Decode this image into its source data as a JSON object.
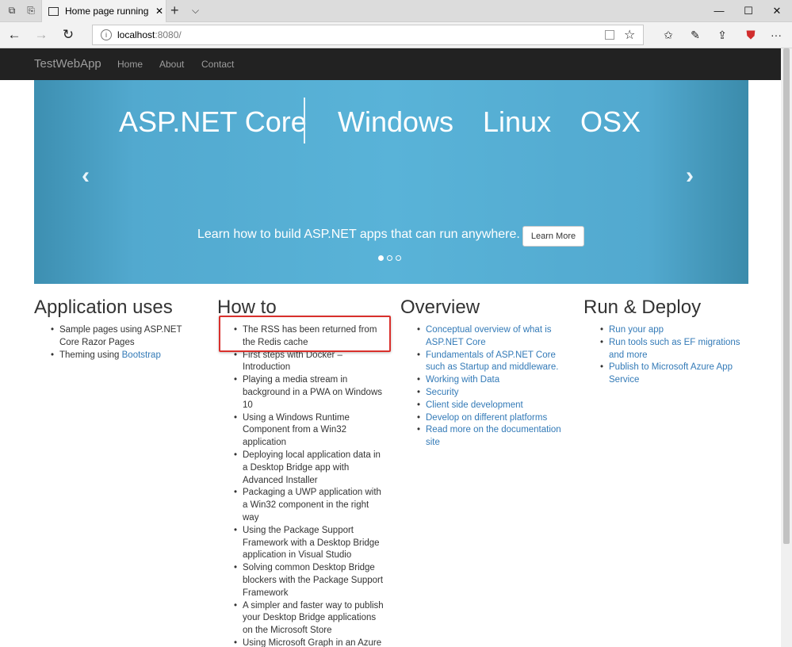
{
  "browser": {
    "tab_title": "Home page running ins",
    "url_host": "localhost",
    "url_port": ":8080/",
    "icons": {
      "back": "←",
      "forward": "→",
      "refresh": "↻",
      "info": "i",
      "star": "☆",
      "favorites": "✩",
      "pen": "✎",
      "share": "⇪",
      "shield": "⛊",
      "new_tab": "+",
      "tab_menu": "⌵",
      "close": "✕",
      "minimize": "—",
      "maximize": "☐"
    }
  },
  "site": {
    "brand": "TestWebApp",
    "nav": [
      "Home",
      "About",
      "Contact"
    ]
  },
  "carousel": {
    "headings": [
      "ASP.NET Core",
      "Windows",
      "Linux",
      "OSX"
    ],
    "prev_arrow": "‹",
    "next_arrow": "›",
    "caption": "Learn how to build ASP.NET apps that can run anywhere.",
    "button": "Learn More",
    "slide_count": 3,
    "active_slide": 1,
    "colors": {
      "background": "#59b3d8"
    }
  },
  "columns": {
    "application_uses": {
      "title": "Application uses",
      "item1": "Sample pages using ASP.NET Core Razor Pages",
      "item2_prefix": "Theming using ",
      "item2_link": "Bootstrap"
    },
    "how_to": {
      "title": "How to",
      "items": [
        "The RSS has been returned from the Redis cache",
        "First steps with Docker – Introduction",
        "Playing a media stream in background in a PWA on Windows 10",
        "Using a Windows Runtime Component from a Win32 application",
        "Deploying local application data in a Desktop Bridge app with Advanced Installer",
        "Packaging a UWP application with a Win32 component in the right way",
        "Using the Package Support Framework with a Desktop Bridge application in Visual Studio",
        "Solving common Desktop Bridge blockers with the Package Support Framework",
        "A simpler and faster way to publish your Desktop Bridge applications on the Microsoft Store",
        "Using Microsoft Graph in an Azure"
      ]
    },
    "overview": {
      "title": "Overview",
      "items": [
        "Conceptual overview of what is ASP.NET Core",
        "Fundamentals of ASP.NET Core such as Startup and middleware.",
        "Working with Data",
        "Security",
        "Client side development",
        "Develop on different platforms",
        "Read more on the documentation site"
      ]
    },
    "run_deploy": {
      "title": "Run & Deploy",
      "items": [
        "Run your app",
        "Run tools such as EF migrations and more",
        "Publish to Microsoft Azure App Service"
      ]
    }
  },
  "colors": {
    "navbar": "#222222",
    "link": "#337ab7",
    "highlight": "#d9302c"
  }
}
